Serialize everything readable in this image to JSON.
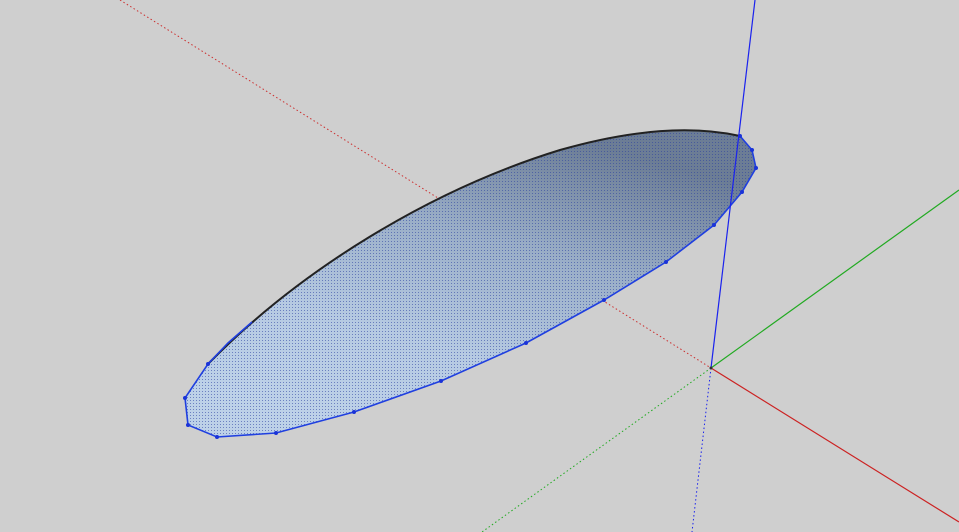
{
  "canvas": {
    "background": "#cfcfcf"
  },
  "axes": {
    "red": "#cc2222",
    "green": "#22aa22",
    "blue": "#1a22ee"
  },
  "shape": {
    "edge_color": "#1f3fe0",
    "vertex_color": "#1a33d8",
    "fill_light": "#b9cde4",
    "fill_dark": "#6c7d95",
    "selected": true
  }
}
